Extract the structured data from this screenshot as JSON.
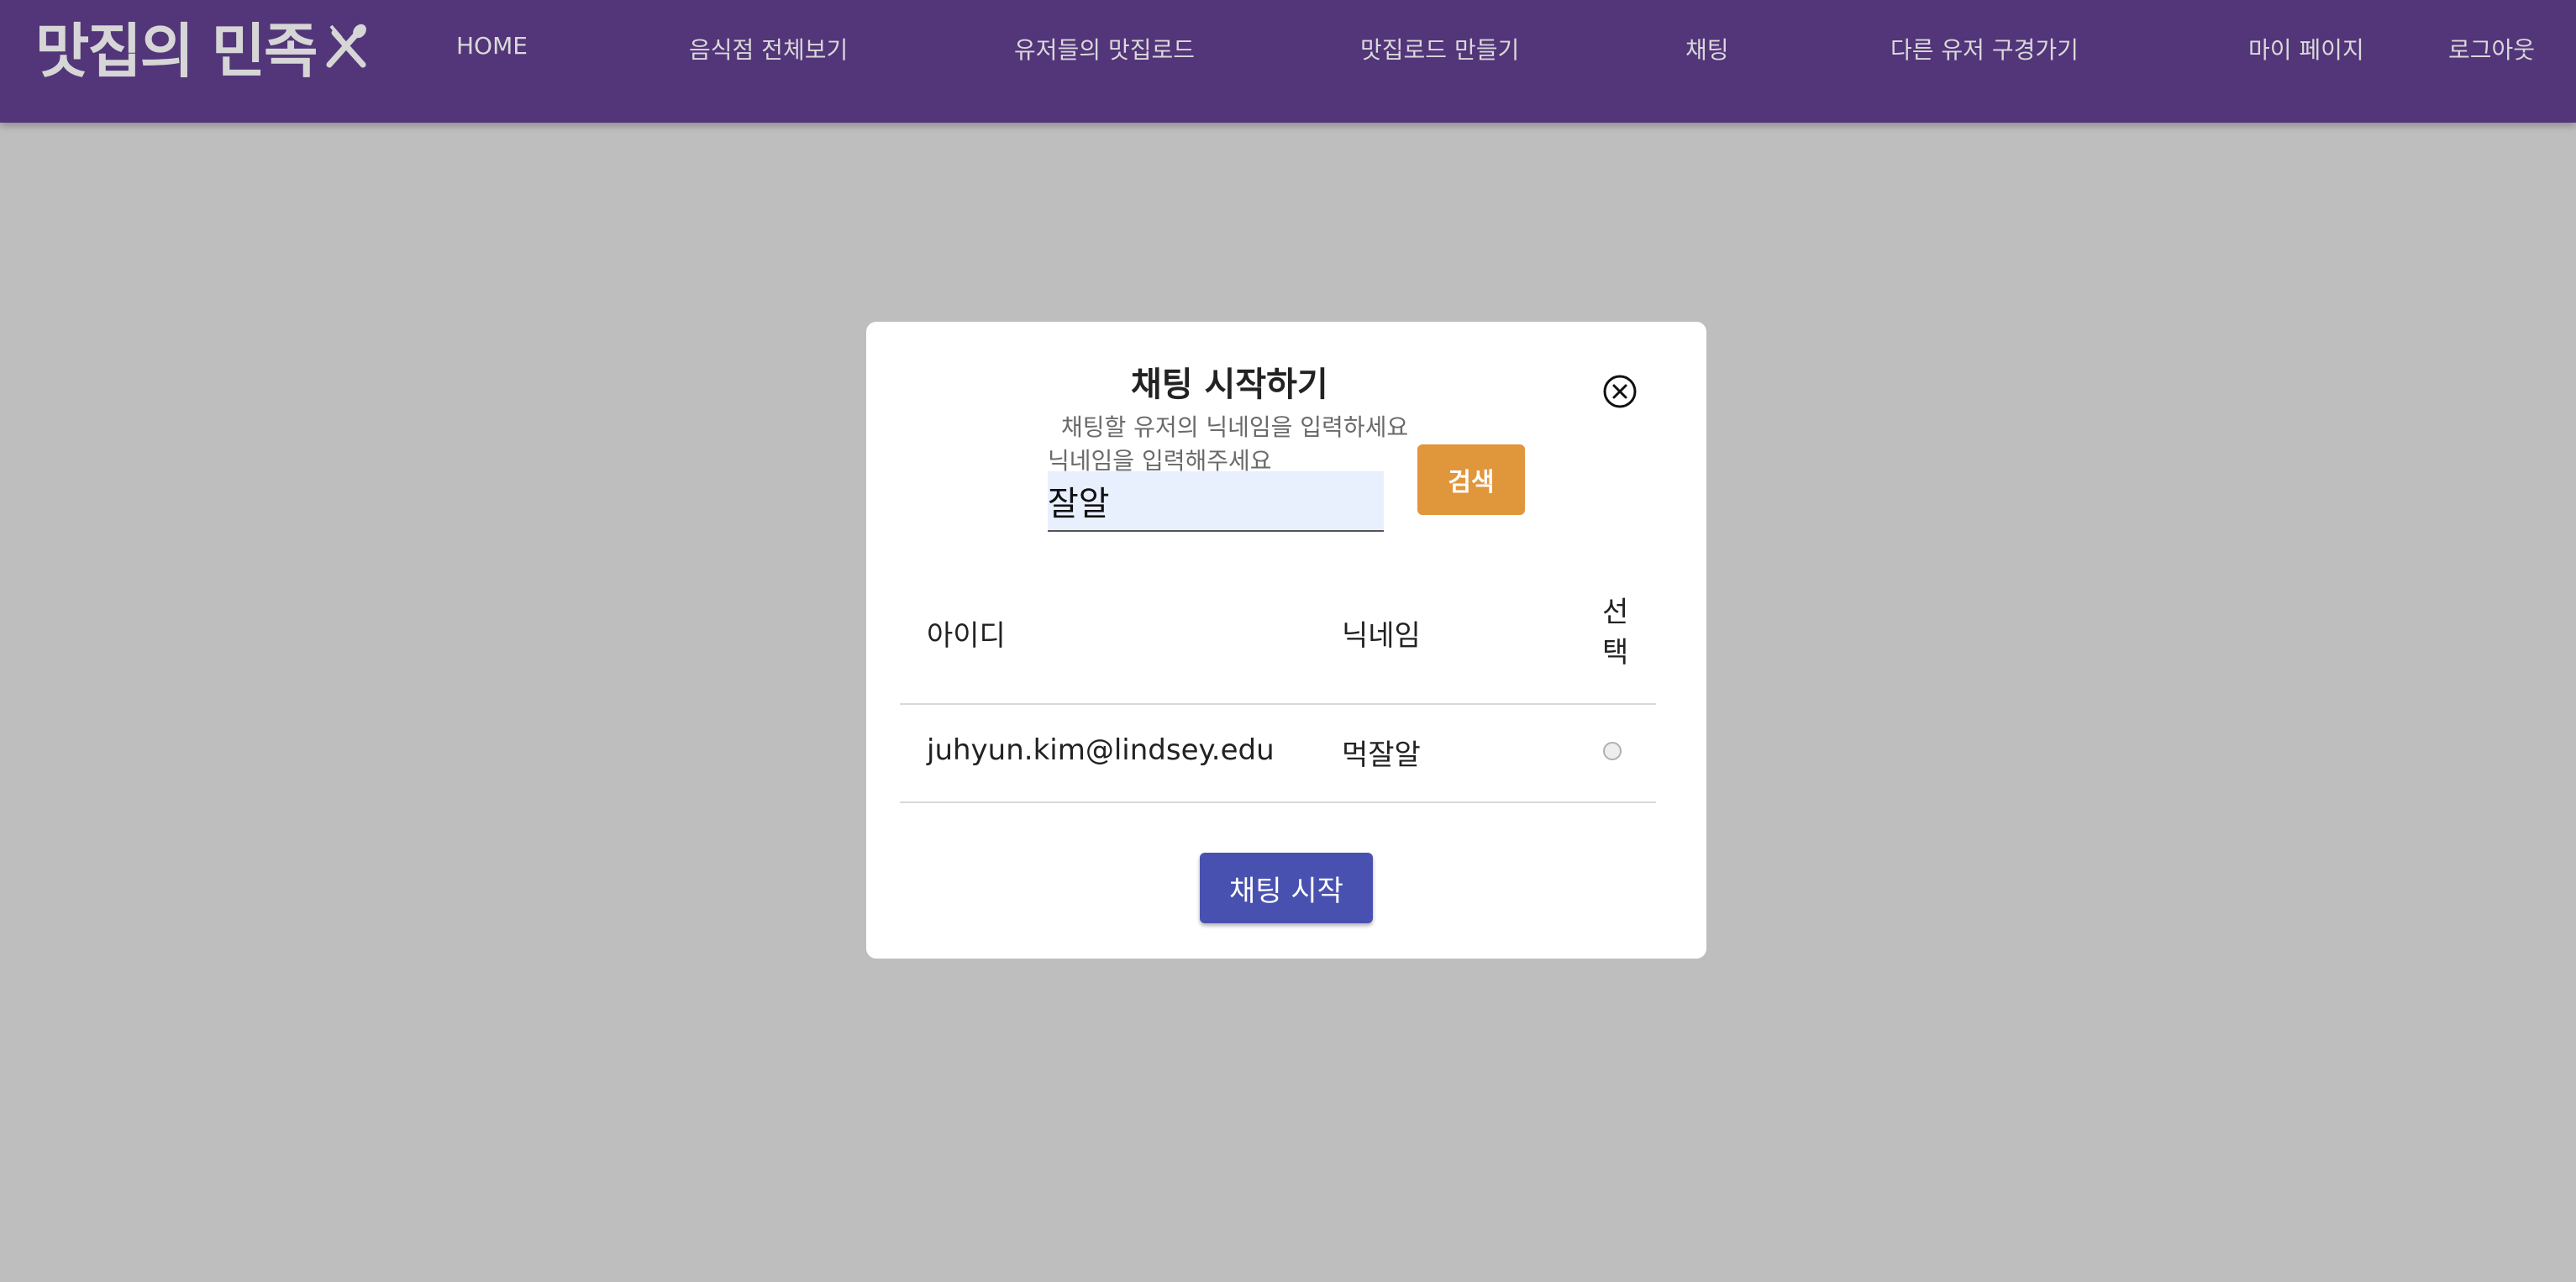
{
  "nav": {
    "logo_text": "맛집의 민족",
    "items": [
      "HOME",
      "음식점 전체보기",
      "유저들의 맛집로드",
      "맛집로드 만들기",
      "채팅",
      "다른 유저 구경가기",
      "마이 페이지",
      "로그아웃"
    ]
  },
  "modal": {
    "title": "채팅 시작하기",
    "hint": "채팅할 유저의 닉네임을 입력하세요",
    "field_label": "닉네임을 입력해주세요",
    "search_value": "잘알",
    "search_button": "검색",
    "table": {
      "headers": [
        "아이디",
        "닉네임",
        "선",
        "택"
      ],
      "rows": [
        {
          "id": "juhyun.kim@lindsey.edu",
          "nickname": "먹잘알"
        }
      ]
    },
    "start_button": "채팅 시작"
  },
  "colors": {
    "navbar": "#533579",
    "overlay": "#bebebe",
    "search_button": "#e0963a",
    "start_button": "#4951b0"
  }
}
